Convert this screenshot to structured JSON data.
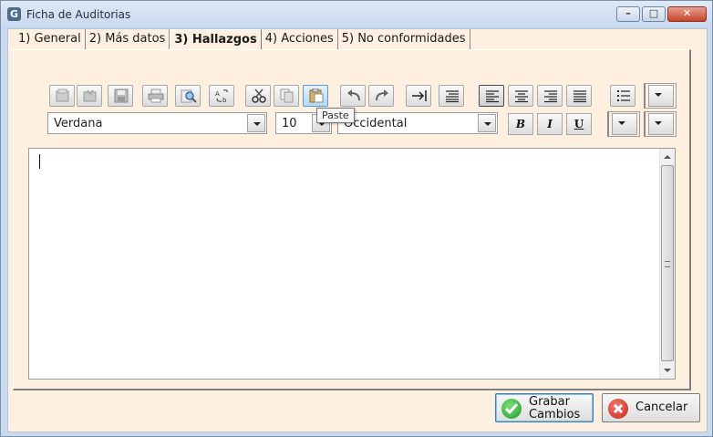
{
  "window": {
    "title": "Ficha de Auditorias",
    "icon_letter": "G"
  },
  "tabs": [
    {
      "label": "1) General"
    },
    {
      "label": "2) Más datos"
    },
    {
      "label": "3) Hallazgos"
    },
    {
      "label": "4) Acciones"
    },
    {
      "label": "5) No conformidades"
    }
  ],
  "editor": {
    "font_name": "Verdana",
    "font_size": "10",
    "charset": "Occidental",
    "tooltip": "Paste",
    "format_bold": "B",
    "format_italic": "I",
    "format_underline": "U"
  },
  "buttons": {
    "save_line1": "Grabar",
    "save_line2": "Cambios",
    "cancel": "Cancelar"
  }
}
